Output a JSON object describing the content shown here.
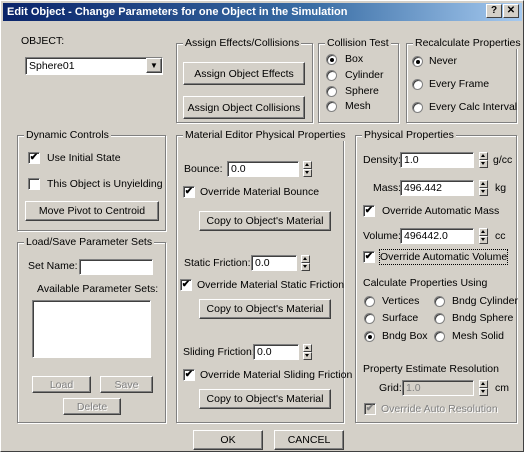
{
  "window": {
    "title": "Edit Object - Change Parameters for one Object in the Simulation",
    "help_label": "?",
    "close_label": "✕"
  },
  "object": {
    "label": "OBJECT:",
    "selected": "Sphere01",
    "dropdown_arrow": "▼"
  },
  "assign": {
    "group_label": "Assign Effects/Collisions",
    "effects_button": "Assign Object Effects",
    "collisions_button": "Assign Object Collisions"
  },
  "collision_test": {
    "group_label": "Collision Test",
    "options": [
      "Box",
      "Cylinder",
      "Sphere",
      "Mesh"
    ],
    "selected": "Box"
  },
  "recalculate": {
    "group_label": "Recalculate Properties",
    "options": [
      "Never",
      "Every Frame",
      "Every Calc Interval"
    ],
    "selected": "Never"
  },
  "dynamic": {
    "group_label": "Dynamic Controls",
    "use_initial_state": "Use Initial State",
    "use_initial_state_checked": true,
    "unyielding": "This Object is Unyielding",
    "unyielding_checked": false,
    "pivot_button": "Move Pivot to Centroid"
  },
  "loadsave": {
    "group_label": "Load/Save Parameter Sets",
    "set_name_label": "Set Name:",
    "set_name_value": "",
    "available_label": "Available Parameter Sets:",
    "load_button": "Load",
    "save_button": "Save",
    "delete_button": "Delete"
  },
  "material": {
    "group_label": "Material Editor Physical Properties",
    "bounce_label": "Bounce:",
    "bounce_value": "0.0",
    "override_bounce": "Override Material Bounce",
    "override_bounce_checked": true,
    "copy_button": "Copy to Object's Material",
    "static_label": "Static Friction:",
    "static_value": "0.0",
    "override_static": "Override Material Static Friction",
    "override_static_checked": true,
    "sliding_label": "Sliding Friction:",
    "sliding_value": "0.0",
    "override_sliding": "Override Material Sliding Friction",
    "override_sliding_checked": true
  },
  "physical": {
    "group_label": "Physical Properties",
    "density_label": "Density:",
    "density_value": "1.0",
    "density_unit": "g/cc",
    "mass_label": "Mass:",
    "mass_value": "496.442",
    "mass_unit": "kg",
    "override_mass": "Override Automatic Mass",
    "override_mass_checked": true,
    "volume_label": "Volume:",
    "volume_value": "496442.0",
    "volume_unit": "cc",
    "override_volume": "Override Automatic Volume",
    "override_volume_checked": true,
    "calc_label": "Calculate Properties Using",
    "calc_options": [
      "Vertices",
      "Bndg Cylinder",
      "Surface",
      "Bndg Sphere",
      "Bndg Box",
      "Mesh Solid"
    ],
    "calc_selected": "Bndg Box",
    "resolution_label": "Property Estimate Resolution",
    "grid_label": "Grid:",
    "grid_value": "1.0",
    "grid_unit": "cm",
    "override_resolution": "Override Auto Resolution",
    "override_resolution_checked": true
  },
  "footer": {
    "ok_button": "OK",
    "cancel_button": "CANCEL"
  },
  "check_mark": "✔"
}
